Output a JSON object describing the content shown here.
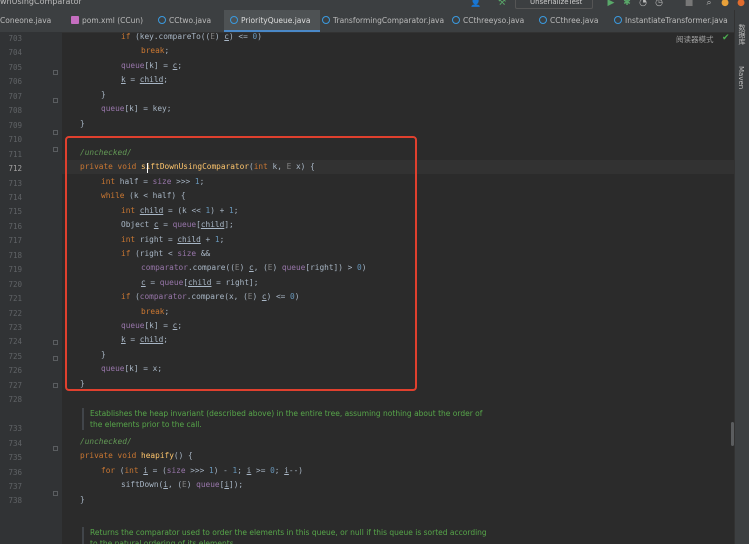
{
  "titlebar": {
    "title": "wnUsingComparator",
    "run_config": "UnserializeTest"
  },
  "tabs": [
    {
      "label": "Coneone.java",
      "icon": "class-icon"
    },
    {
      "label": "pom.xml (CCun)",
      "icon": "maven-icon"
    },
    {
      "label": "CCtwo.java",
      "icon": "class-icon"
    },
    {
      "label": "PriorityQueue.java",
      "icon": "class-icon",
      "active": true
    },
    {
      "label": "TransformingComparator.java",
      "icon": "class-icon"
    },
    {
      "label": "CCthreeyso.java",
      "icon": "class-icon"
    },
    {
      "label": "CCthree.java",
      "icon": "class-icon"
    },
    {
      "label": "InstantiateTransformer.java",
      "icon": "class-icon"
    }
  ],
  "right_panel": {
    "tab1": "数据库",
    "tab2": "Maven"
  },
  "reader_mode": "阅读器模式",
  "line_numbers": [
    "703",
    "704",
    "705",
    "706",
    "707",
    "708",
    "709",
    "710",
    "711",
    "712",
    "713",
    "714",
    "715",
    "716",
    "717",
    "718",
    "719",
    "720",
    "721",
    "722",
    "723",
    "724",
    "725",
    "726",
    "727",
    "728",
    "733",
    "734",
    "735",
    "736",
    "737",
    "738"
  ],
  "doc_comments": [
    "Establishes the heap invariant (described above) in the entire tree, assuming nothing about the order of the elements prior to the call.",
    "Returns the comparator used to order the elements in this queue, or null if this queue is sorted according to the natural ordering of its elements."
  ],
  "colors": {
    "highlight_box": "#e0402e",
    "keyword": "#cc7832",
    "number": "#6897bb",
    "method": "#ffc66d",
    "field": "#9876aa",
    "comment": "#629755"
  }
}
